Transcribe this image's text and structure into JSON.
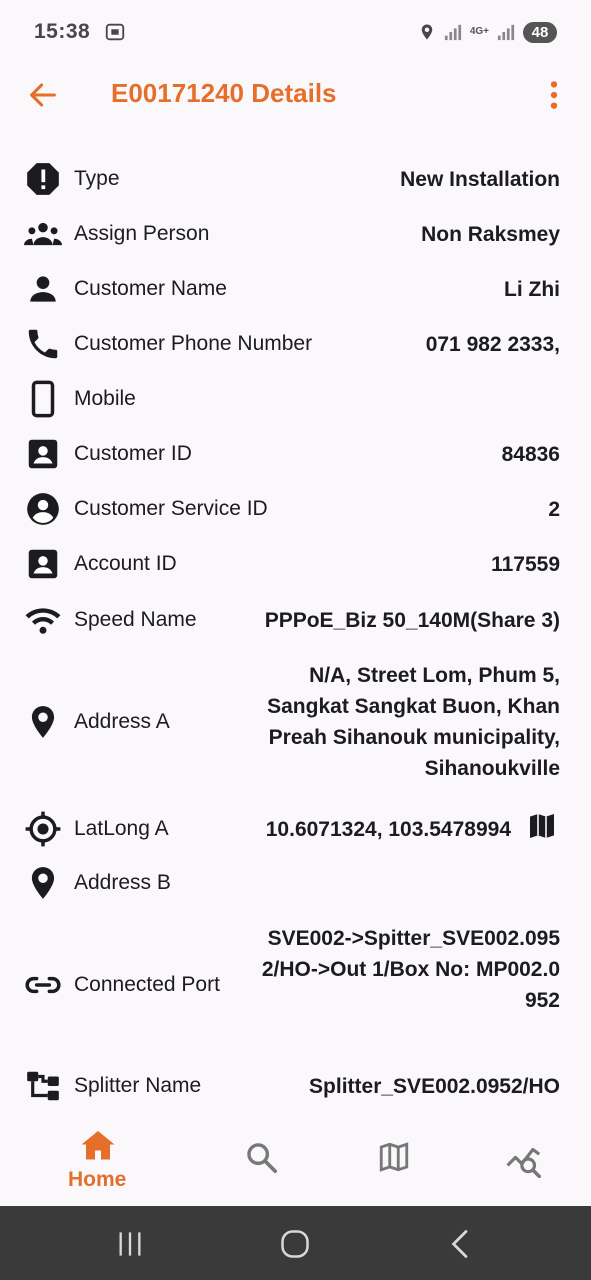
{
  "status_bar": {
    "time": "15:38",
    "network": "4G+",
    "battery": "48"
  },
  "header": {
    "title": "E00171240 Details"
  },
  "details": [
    {
      "label": "Type",
      "value": "New Installation",
      "icon": "alert-octagon-icon"
    },
    {
      "label": "Assign Person",
      "value": "Non Raksmey",
      "icon": "group-icon"
    },
    {
      "label": "Customer Name",
      "value": "Li Zhi",
      "icon": "person-icon"
    },
    {
      "label": "Customer Phone Number",
      "value": "071 982 2333,",
      "icon": "phone-icon"
    },
    {
      "label": "Mobile",
      "value": "",
      "icon": "smartphone-icon"
    },
    {
      "label": "Customer ID",
      "value": "84836",
      "icon": "account-box-icon"
    },
    {
      "label": "Customer Service ID",
      "value": "2",
      "icon": "account-circle-icon"
    },
    {
      "label": "Account ID",
      "value": "117559",
      "icon": "account-box-icon"
    },
    {
      "label": "Speed Name",
      "value": "PPPoE_Biz 50_140M(Share 3)",
      "icon": "wifi-icon"
    },
    {
      "label": "Address A",
      "value": "N/A, Street Lom, Phum 5, Sangkat Sangkat Buon, Khan Preah Sihanouk municipality, Sihanoukville",
      "icon": "location-pin-icon"
    },
    {
      "label": "LatLong A",
      "value": "10.6071324, 103.5478994",
      "icon": "gps-target-icon"
    },
    {
      "label": "Address B",
      "value": "",
      "icon": "location-pin-icon"
    },
    {
      "label": "Connected Port",
      "value": "SVE002->Spitter_SVE002.0952/HO->Out 1/Box No: MP002.0952",
      "icon": "link-icon"
    },
    {
      "label": "Splitter Name",
      "value": "Splitter_SVE002.0952/HO",
      "icon": "tree-icon"
    }
  ],
  "bottom_nav": {
    "home_label": "Home",
    "active_color": "#e56f2a"
  },
  "colors": {
    "accent": "#e56f2a",
    "text": "#1c1b1f",
    "background": "#fbf8fc"
  }
}
